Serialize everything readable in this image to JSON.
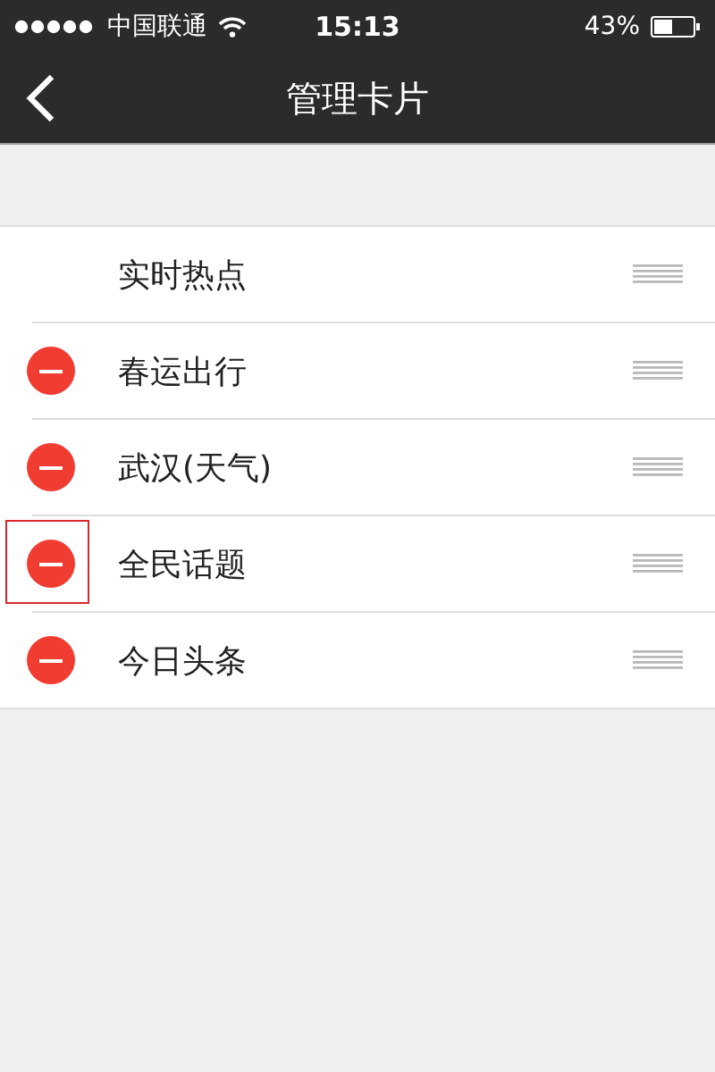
{
  "status_bar": {
    "carrier": "中国联通",
    "time": "15:13",
    "battery": "43%"
  },
  "nav_bar": {
    "title": "管理卡片"
  },
  "cards": [
    {
      "label": "实时热点",
      "deletable": false,
      "highlighted": false
    },
    {
      "label": "春运出行",
      "deletable": true,
      "highlighted": false
    },
    {
      "label": "武汉(天气)",
      "deletable": true,
      "highlighted": false
    },
    {
      "label": "全民话题",
      "deletable": true,
      "highlighted": true
    },
    {
      "label": "今日头条",
      "deletable": true,
      "highlighted": false
    }
  ]
}
